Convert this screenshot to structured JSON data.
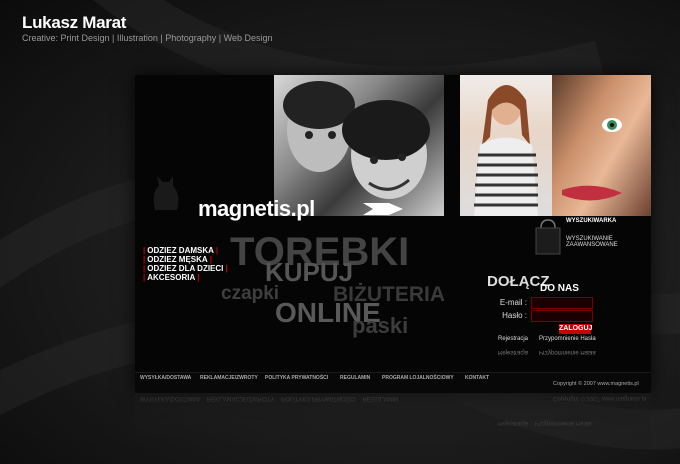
{
  "header": {
    "name": "Lukasz Marat",
    "creative_label": "Creative:",
    "services": "Print Design | Illustration | Photography | Web Design"
  },
  "site": {
    "logo": "magnetis.pl",
    "search_button": "WYSZUKIWARKA",
    "advanced_search": "WYSZUKIWANIE ZAAWANSOWANE",
    "menu": [
      "ODZIEZ DAMSKA",
      "ODZIEZ MĘSKA",
      "ODZIEZ DLA DZIECI",
      "AKCESORIA"
    ],
    "tagline_words": {
      "torebki": "TOREBKI",
      "kupuj": "KUPUJ",
      "czapki": "czapki",
      "bizuteria": "BIŻUTERIA",
      "online": "ONLINE",
      "paski": "paski"
    },
    "login": {
      "title_part1": "DOŁĄCZ",
      "title_part2": "DO NAS",
      "email_label": "E-mail :",
      "password_label": "Hasło :",
      "login_button": "ZALOGUJ",
      "register_link": "Rejestracja",
      "remind_link": "Przypomnienie Hasła"
    },
    "footer": {
      "links": [
        "WYSYŁKA/DOSTAWA",
        "REKLAMACJE/ZWROTY",
        "POLITYKA PRYWATNOŚCI",
        "REGULAMIN",
        "PROGRAM LOJALNOŚCIOWY",
        "KONTAKT"
      ],
      "copyright": "Copyright © 2007 www.magnetis.pl"
    }
  }
}
